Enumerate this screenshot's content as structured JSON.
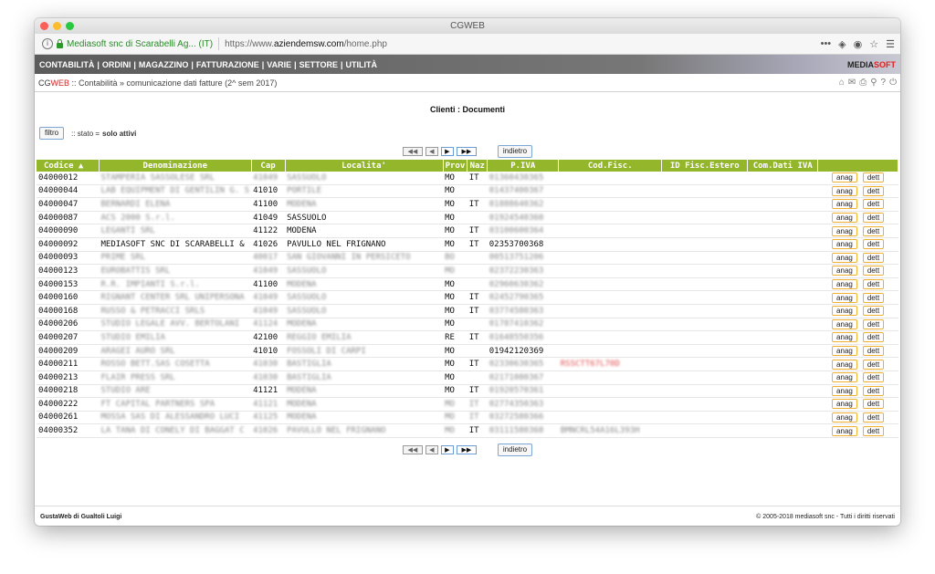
{
  "window": {
    "title": "CGWEB"
  },
  "urlbar": {
    "identity": "Mediasoft snc di Scarabelli Ag... (IT)",
    "url_prefix": "https://www.",
    "url_domain": "aziendemsw.com",
    "url_path": "/home.php"
  },
  "menu": [
    "CONTABILITÀ",
    "ORDINI",
    "MAGAZZINO",
    "FATTURAZIONE",
    "VARIE",
    "SETTORE",
    "UTILITÀ"
  ],
  "logo": {
    "part1": "MEDIA",
    "part2": "SOFT"
  },
  "breadcrumb": {
    "app1": "CG",
    "app2": "WEB",
    "path": " :: Contabilità » comunicazione dati fatture (2^ sem 2017)"
  },
  "page": {
    "title": "Clienti : Documenti"
  },
  "filter": {
    "button": "filtro",
    "text": ":: stato = ",
    "value": "solo attivi"
  },
  "pager": {
    "first": "◀◀",
    "prev": "◀",
    "next": "▶",
    "last": "▶▶",
    "back": "indietro"
  },
  "table": {
    "headers": [
      "Codice ▲",
      "Denominazione",
      "Cap",
      "Localita'",
      "Prov",
      "Naz",
      "P.IVA",
      "Cod.Fisc.",
      "ID Fisc.Estero",
      "Com.Dati IVA",
      ""
    ],
    "action_anag": "anag",
    "action_dett": "dett",
    "rows": [
      [
        "04000012",
        "STAMPERIA SASSOLESE SRL",
        "41049",
        "SASSUOLO",
        "MO",
        "IT",
        "01360430365",
        ""
      ],
      [
        "04000044",
        "LAB EQUIPMENT DI GENTILIN G. S",
        "41010",
        "PORTILE",
        "MO",
        "",
        "01437400367",
        ""
      ],
      [
        "04000047",
        "BERNARDI ELENA",
        "41100",
        "MODENA",
        "MO",
        "IT",
        "01888640362",
        ""
      ],
      [
        "04000087",
        "ACS 2000 S.r.l.",
        "41049",
        "SASSUOLO",
        "MO",
        "",
        "01924540360",
        ""
      ],
      [
        "04000090",
        "LEGANTI SRL",
        "41122",
        "MODENA",
        "MO",
        "IT",
        "03100600364",
        ""
      ],
      [
        "04000092",
        "MEDIASOFT SNC DI SCARABELLI &",
        "41026",
        "PAVULLO NEL FRIGNANO",
        "MO",
        "IT",
        "02353700368",
        ""
      ],
      [
        "04000093",
        "PRIME SRL",
        "40017",
        "SAN GIOVANNI IN PERSICETO",
        "BO",
        "",
        "00513751206",
        ""
      ],
      [
        "04000123",
        "EUROBATTIS SRL",
        "41049",
        "SASSUOLO",
        "MO",
        "",
        "02372230363",
        ""
      ],
      [
        "04000153",
        "R.R. IMPIANTI S.r.l.",
        "41100",
        "MODENA",
        "MO",
        "",
        "02960630362",
        ""
      ],
      [
        "04000160",
        "RIGNANT CENTER SRL UNIPERSONA",
        "41049",
        "SASSUOLO",
        "MO",
        "IT",
        "02452790365",
        ""
      ],
      [
        "04000168",
        "RUSSO & PETRACCI SRLS",
        "41049",
        "SASSUOLO",
        "MO",
        "IT",
        "03774580363",
        ""
      ],
      [
        "04000206",
        "STUDIO LEGALE AVV. BERTOLANI",
        "41124",
        "MODENA",
        "MO",
        "",
        "01787410362",
        ""
      ],
      [
        "04000207",
        "STUDIO EMILIA",
        "42100",
        "REGGIO EMILIA",
        "RE",
        "IT",
        "01648550356",
        ""
      ],
      [
        "04000209",
        "ARAGEI AURO SRL",
        "41010",
        "FOSSOLI DI CARPI",
        "MO",
        "",
        "01942120369",
        ""
      ],
      [
        "04000211",
        "ROSSO BETT.SAS COSETTA",
        "41030",
        "BASTIGLIA",
        "MO",
        "IT",
        "02330630365",
        "RSSCTT67L70D"
      ],
      [
        "04000213",
        "FLAIR PRESS SRL",
        "41030",
        "BASTIGLIA",
        "MO",
        "",
        "02171080367",
        ""
      ],
      [
        "04000218",
        "STUDIO ARE",
        "41121",
        "MODENA",
        "MO",
        "IT",
        "01920570361",
        ""
      ],
      [
        "04000222",
        "FT CAPITAL PARTNERS SPA",
        "41121",
        "MODENA",
        "MO",
        "IT",
        "02774350363",
        ""
      ],
      [
        "04000261",
        "MOSSA SAS DI ALESSANDRO LUCI",
        "41125",
        "MODENA",
        "MO",
        "IT",
        "03272580366",
        ""
      ],
      [
        "04000352",
        "LA TANA DI CONELY DI BAGGAT C",
        "41026",
        "PAVULLO NEL FRIGNANO",
        "MO",
        "IT",
        "03111580368",
        "BMNCRL54A16L393H"
      ]
    ]
  },
  "footer": {
    "left": "GustaWeb di Gualtoli Luigi",
    "right": "© 2005-2018 mediasoft snc - Tutti i diritti riservati"
  },
  "icons": [
    "home-icon",
    "mail-icon",
    "print-icon",
    "search-icon",
    "help-icon",
    "power-icon"
  ]
}
